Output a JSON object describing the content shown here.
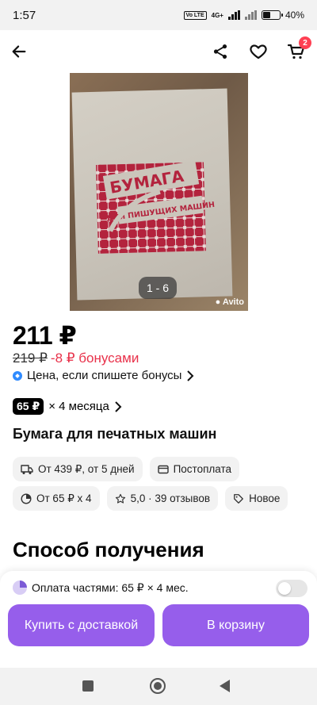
{
  "status": {
    "time": "1:57",
    "network": "4G+",
    "volte": "Vo LTE",
    "battery": "40%",
    "battery_level": 0.4
  },
  "topbar": {
    "cart_count": "2"
  },
  "gallery": {
    "counter": "1 - 6",
    "watermark": "Avito",
    "cover_title": "БУМАГА",
    "cover_subtitle": "ДЛЯ ПИШУЩИХ МАШИН"
  },
  "product": {
    "price": "211 ₽",
    "old_price": "219 ₽",
    "bonus_discount": "-8 ₽ бонусами",
    "bonus_info": "Цена, если спишете бонусы",
    "installment_badge": "65 ₽",
    "installment_term": "× 4 месяца",
    "title": "Бумага для печатных машин"
  },
  "chips": {
    "delivery": "От 439 ₽, от 5 дней",
    "postpay": "Постоплата",
    "installment": "От 65 ₽ х 4",
    "rating": "5,0 · 39 отзывов",
    "condition": "Новое"
  },
  "section": {
    "delivery_title": "Способ получения"
  },
  "sheet": {
    "installment_line": "Оплата частями: 65 ₽ × 4 мес.",
    "buy_button": "Купить с доставкой",
    "cart_button": "В корзину"
  },
  "colors": {
    "accent": "#965eeb",
    "discount_red": "#e8314a",
    "badge_red": "#ff4053",
    "bonus_blue": "#2f8bff",
    "cover_red": "#b3233d"
  }
}
